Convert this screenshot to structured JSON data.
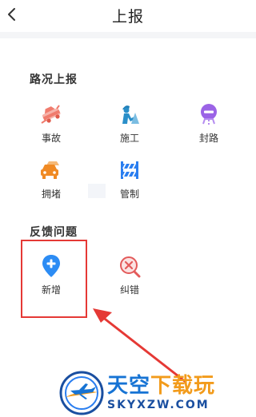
{
  "header": {
    "title": "上报"
  },
  "road_report": {
    "title": "路况上报",
    "items": [
      {
        "label": "事故"
      },
      {
        "label": "施工"
      },
      {
        "label": "封路"
      },
      {
        "label": "拥堵"
      },
      {
        "label": "管制"
      }
    ]
  },
  "feedback": {
    "title": "反馈问题",
    "items": [
      {
        "label": "新增"
      },
      {
        "label": "纠错"
      }
    ]
  },
  "watermark": {
    "brand_main": "天空",
    "brand_accent": "下载玩",
    "domain": "SKYXZW.COM"
  },
  "colors": {
    "accident": "#f07c6e",
    "construction": "#2a8fc9",
    "road_closure": "#9b63e6",
    "congestion": "#f08a24",
    "control": "#2a7ef0",
    "add_new": "#2c8cf4",
    "correction": "#e35a5a",
    "highlight": "#e53935"
  },
  "icons": {
    "back": "chevron-left-icon",
    "accident": "car-crash-icon",
    "construction": "construction-worker-icon",
    "road_closure": "road-closed-icon",
    "congestion": "car-traffic-icon",
    "control": "barrier-icon",
    "add_new": "location-pin-plus-icon",
    "correction": "magnifier-x-icon"
  }
}
